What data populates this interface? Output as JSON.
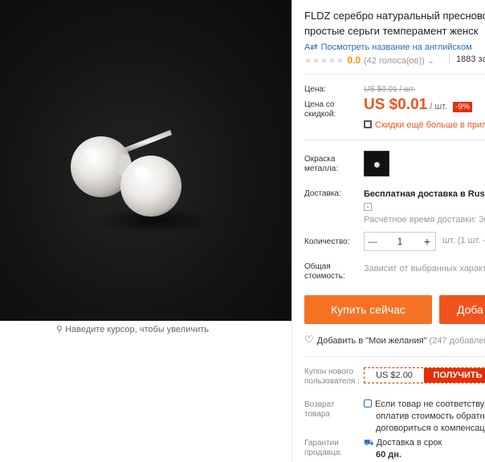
{
  "product": {
    "title": "FLDZ серебро натуральный пресновод...",
    "title_line1": "FLDZ серебро натуральный пресновод",
    "title_line2": "простые серьги темперамент женск",
    "translate_link": "Посмотреть название на английском",
    "rating_score": "0.0",
    "rating_votes": "(42 голоса(ов))",
    "orders": "1883 за"
  },
  "price": {
    "label": "Цена:",
    "old_price": "US $0.01 / шт.",
    "discount_label": "Цена со скидкой:",
    "price": "US $0.01",
    "unit": "/ шт.",
    "discount": "-9%",
    "promo": "Скидки ещё больше в прил"
  },
  "options": {
    "metal_label": "Окраска металла:",
    "swatch_icon": "pearl-thumbnail"
  },
  "shipping": {
    "label": "Доставка:",
    "text": "Бесплатная доставка в Russ",
    "estimate": "Расчётное время доставки: 30"
  },
  "quantity": {
    "label": "Количество:",
    "value": "1",
    "unit_text": "шт. (1 шт. -"
  },
  "total": {
    "label": "Общая стоимость:",
    "text": "Зависит от выбранных характ"
  },
  "actions": {
    "buy_now": "Купить сейчас",
    "add_to_cart": "Доба",
    "wishlist": "Добавить в \"Мои желания\"",
    "wishlist_count": "(247 добавлен"
  },
  "coupon": {
    "label": "Купон нового пользователя :",
    "amount": "US $2.00",
    "get": "ПОЛУЧИТЬ"
  },
  "returns": {
    "label": "Возврат товара",
    "line1": "Если товар не соответству",
    "line2": "оплатив стоимость обратн",
    "line3": "договориться о компенсац"
  },
  "guarantee": {
    "label": "Гарантии продавца:",
    "line1": "Доставка в срок",
    "line2": "60 дн."
  },
  "image": {
    "zoom_hint": "Наведите курсор, чтобы увеличить"
  },
  "colors": {
    "accent": "#f57224",
    "price": "#f0541e",
    "link": "#2a6bb8"
  }
}
